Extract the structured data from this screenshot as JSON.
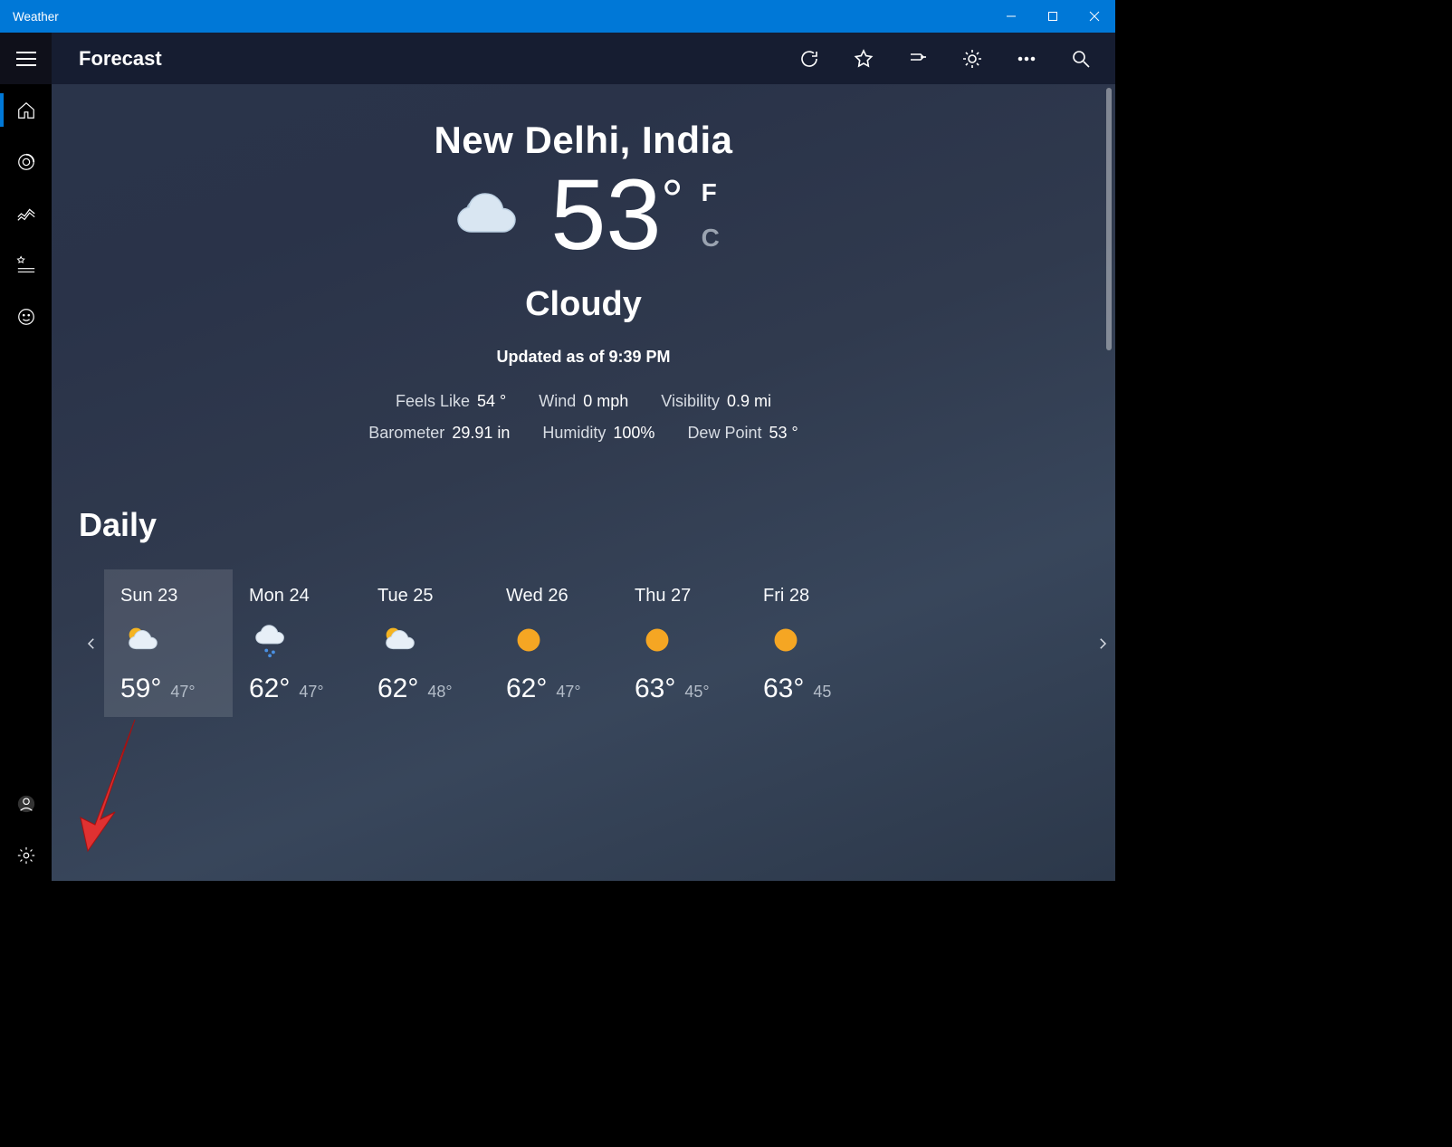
{
  "window": {
    "title": "Weather"
  },
  "topbar": {
    "title": "Forecast"
  },
  "location": "New Delhi, India",
  "current": {
    "temp": "53",
    "unit_f": "F",
    "unit_c": "C",
    "condition": "Cloudy",
    "updated": "Updated as of 9:39 PM"
  },
  "details1": [
    {
      "label": "Feels Like",
      "value": "54 °"
    },
    {
      "label": "Wind",
      "value": "0 mph"
    },
    {
      "label": "Visibility",
      "value": "0.9 mi"
    }
  ],
  "details2": [
    {
      "label": "Barometer",
      "value": "29.91 in"
    },
    {
      "label": "Humidity",
      "value": "100%"
    },
    {
      "label": "Dew Point",
      "value": "53 °"
    }
  ],
  "daily": {
    "title": "Daily",
    "days": [
      {
        "label": "Sun 23",
        "hi": "59°",
        "lo": "47°",
        "icon": "partly-cloudy",
        "selected": true
      },
      {
        "label": "Mon 24",
        "hi": "62°",
        "lo": "47°",
        "icon": "rain-cloud",
        "selected": false
      },
      {
        "label": "Tue 25",
        "hi": "62°",
        "lo": "48°",
        "icon": "partly-cloudy",
        "selected": false
      },
      {
        "label": "Wed 26",
        "hi": "62°",
        "lo": "47°",
        "icon": "sunny",
        "selected": false
      },
      {
        "label": "Thu 27",
        "hi": "63°",
        "lo": "45°",
        "icon": "sunny",
        "selected": false
      },
      {
        "label": "Fri 28",
        "hi": "63°",
        "lo": "45",
        "icon": "sunny",
        "selected": false
      }
    ]
  }
}
